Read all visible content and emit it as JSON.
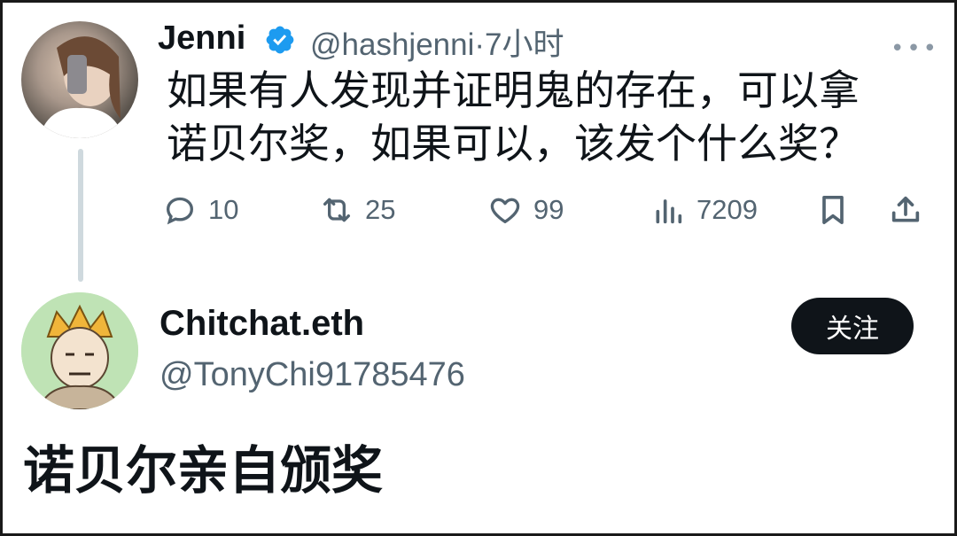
{
  "tweet": {
    "author_name": "Jenni",
    "author_handle": "@hashjenni",
    "time": "·7小时",
    "more_label": "•••",
    "text": "如果有人发现并证明鬼的存在，可以拿\n诺贝尔奖，如果可以，该发个什么奖？",
    "actions": {
      "replies": "10",
      "retweets": "25",
      "likes": "99",
      "views": "7209"
    }
  },
  "reply": {
    "author_name": "Chitchat.eth",
    "author_handle": "@TonyChi91785476",
    "follow_label": "关注",
    "text": "诺贝尔亲自颁奖"
  },
  "colors": {
    "text_primary": "#0f1419",
    "text_secondary": "#536471",
    "verified_blue": "#1d9bf0",
    "thread_line": "#cfd9de",
    "follow_bg": "#0f1419"
  },
  "icons": {
    "verified": "verified-badge-icon",
    "reply": "reply-icon",
    "retweet": "retweet-icon",
    "like": "heart-icon",
    "views": "views-icon",
    "bookmark": "bookmark-icon",
    "share": "share-icon"
  }
}
